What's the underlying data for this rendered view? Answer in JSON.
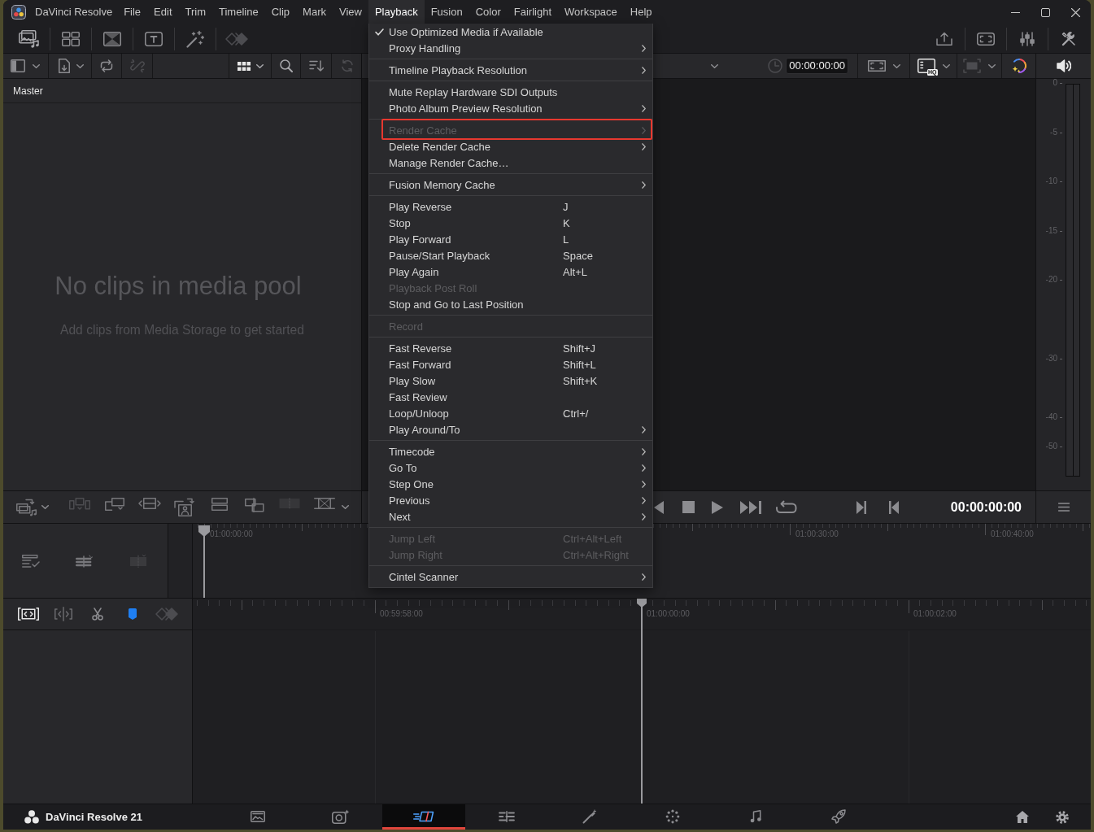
{
  "title_bar": {
    "app_name": "DaVinci Resolve",
    "menus": [
      {
        "label": "File",
        "selected": false
      },
      {
        "label": "Edit",
        "selected": false
      },
      {
        "label": "Trim",
        "selected": false
      },
      {
        "label": "Timeline",
        "selected": false
      },
      {
        "label": "Clip",
        "selected": false
      },
      {
        "label": "Mark",
        "selected": false
      },
      {
        "label": "View",
        "selected": false
      },
      {
        "label": "Playback",
        "selected": true
      },
      {
        "label": "Fusion",
        "selected": false
      },
      {
        "label": "Color",
        "selected": false
      },
      {
        "label": "Fairlight",
        "selected": false
      },
      {
        "label": "Workspace",
        "selected": false
      },
      {
        "label": "Help",
        "selected": false
      }
    ]
  },
  "playback_menu": {
    "sections": [
      {
        "items": [
          {
            "label": "Use Optimized Media if Available",
            "checked": true,
            "disabled": false,
            "submenu": false,
            "highlighted": false
          },
          {
            "label": "Proxy Handling",
            "checked": false,
            "disabled": false,
            "submenu": true,
            "highlighted": false
          }
        ]
      },
      {
        "items": [
          {
            "label": "Timeline Playback Resolution",
            "checked": false,
            "disabled": false,
            "submenu": true,
            "highlighted": false
          }
        ]
      },
      {
        "items": [
          {
            "label": "Mute Replay Hardware SDI Outputs",
            "checked": false,
            "disabled": false,
            "submenu": false,
            "highlighted": false
          },
          {
            "label": "Photo Album Preview Resolution",
            "checked": false,
            "disabled": false,
            "submenu": true,
            "highlighted": false
          }
        ]
      },
      {
        "items": [
          {
            "label": "Render Cache",
            "checked": false,
            "disabled": true,
            "submenu": true,
            "highlighted": true
          },
          {
            "label": "Delete Render Cache",
            "checked": false,
            "disabled": false,
            "submenu": true,
            "highlighted": false
          },
          {
            "label": "Manage Render Cache…",
            "checked": false,
            "disabled": false,
            "submenu": false,
            "highlighted": false
          }
        ]
      },
      {
        "items": [
          {
            "label": "Fusion Memory Cache",
            "checked": false,
            "disabled": false,
            "submenu": true,
            "highlighted": false
          }
        ]
      },
      {
        "items": [
          {
            "label": "Play Reverse",
            "shortcut": "J",
            "checked": false,
            "disabled": false,
            "submenu": false,
            "highlighted": false
          },
          {
            "label": "Stop",
            "shortcut": "K",
            "checked": false,
            "disabled": false,
            "submenu": false,
            "highlighted": false
          },
          {
            "label": "Play Forward",
            "shortcut": "L",
            "checked": false,
            "disabled": false,
            "submenu": false,
            "highlighted": false
          },
          {
            "label": "Pause/Start Playback",
            "shortcut": "Space",
            "checked": false,
            "disabled": false,
            "submenu": false,
            "highlighted": false
          },
          {
            "label": "Play Again",
            "shortcut": "Alt+L",
            "checked": false,
            "disabled": false,
            "submenu": false,
            "highlighted": false
          },
          {
            "label": "Playback Post Roll",
            "checked": false,
            "disabled": true,
            "submenu": false,
            "highlighted": false
          },
          {
            "label": "Stop and Go to Last Position",
            "checked": false,
            "disabled": false,
            "submenu": false,
            "highlighted": false
          }
        ]
      },
      {
        "items": [
          {
            "label": "Record",
            "checked": false,
            "disabled": true,
            "submenu": false,
            "highlighted": false
          }
        ]
      },
      {
        "items": [
          {
            "label": "Fast Reverse",
            "shortcut": "Shift+J",
            "checked": false,
            "disabled": false,
            "submenu": false,
            "highlighted": false
          },
          {
            "label": "Fast Forward",
            "shortcut": "Shift+L",
            "checked": false,
            "disabled": false,
            "submenu": false,
            "highlighted": false
          },
          {
            "label": "Play Slow",
            "shortcut": "Shift+K",
            "checked": false,
            "disabled": false,
            "submenu": false,
            "highlighted": false
          },
          {
            "label": "Fast Review",
            "checked": false,
            "disabled": false,
            "submenu": false,
            "highlighted": false
          },
          {
            "label": "Loop/Unloop",
            "shortcut": "Ctrl+/",
            "checked": false,
            "disabled": false,
            "submenu": false,
            "highlighted": false
          },
          {
            "label": "Play Around/To",
            "checked": false,
            "disabled": false,
            "submenu": true,
            "highlighted": false
          }
        ]
      },
      {
        "items": [
          {
            "label": "Timecode",
            "checked": false,
            "disabled": false,
            "submenu": true,
            "highlighted": false
          },
          {
            "label": "Go To",
            "checked": false,
            "disabled": false,
            "submenu": true,
            "highlighted": false
          },
          {
            "label": "Step One",
            "checked": false,
            "disabled": false,
            "submenu": true,
            "highlighted": false
          },
          {
            "label": "Previous",
            "checked": false,
            "disabled": false,
            "submenu": true,
            "highlighted": false
          },
          {
            "label": "Next",
            "checked": false,
            "disabled": false,
            "submenu": true,
            "highlighted": false
          }
        ]
      },
      {
        "items": [
          {
            "label": "Jump Left",
            "shortcut": "Ctrl+Alt+Left",
            "checked": false,
            "disabled": true,
            "submenu": false,
            "highlighted": false
          },
          {
            "label": "Jump Right",
            "shortcut": "Ctrl+Alt+Right",
            "checked": false,
            "disabled": true,
            "submenu": false,
            "highlighted": false
          }
        ]
      },
      {
        "items": [
          {
            "label": "Cintel Scanner",
            "checked": false,
            "disabled": false,
            "submenu": true,
            "highlighted": false
          }
        ]
      }
    ]
  },
  "media_pool": {
    "bin": "Master",
    "empty_title": "No clips in media pool",
    "empty_hint": "Add clips from Media Storage to get started"
  },
  "viewer": {
    "timecode": "00:00:00:00",
    "quality_badge": "HQ"
  },
  "audio_meter": {
    "scale": [
      "0",
      "-5",
      "-10",
      "-15",
      "-20",
      "-30",
      "-40",
      "-50"
    ]
  },
  "transport": {
    "timecode": "00:00:00:00"
  },
  "upper_timeline": {
    "ruler": [
      "01:00:00:00",
      "01:00:30:00",
      "01:00:40:00"
    ]
  },
  "lower_timeline": {
    "ruler": [
      "00:59:58:00",
      "01:00:00:00",
      "01:00:02:00"
    ]
  },
  "page_bar": {
    "product": "DaVinci Resolve 21",
    "pages": [
      {
        "kind": "media",
        "selected": false
      },
      {
        "kind": "photo",
        "selected": false
      },
      {
        "kind": "cut",
        "selected": true
      },
      {
        "kind": "edit",
        "selected": false
      },
      {
        "kind": "fusion",
        "selected": false
      },
      {
        "kind": "color",
        "selected": false
      },
      {
        "kind": "fairlight",
        "selected": false
      },
      {
        "kind": "deliver",
        "selected": false
      }
    ]
  }
}
